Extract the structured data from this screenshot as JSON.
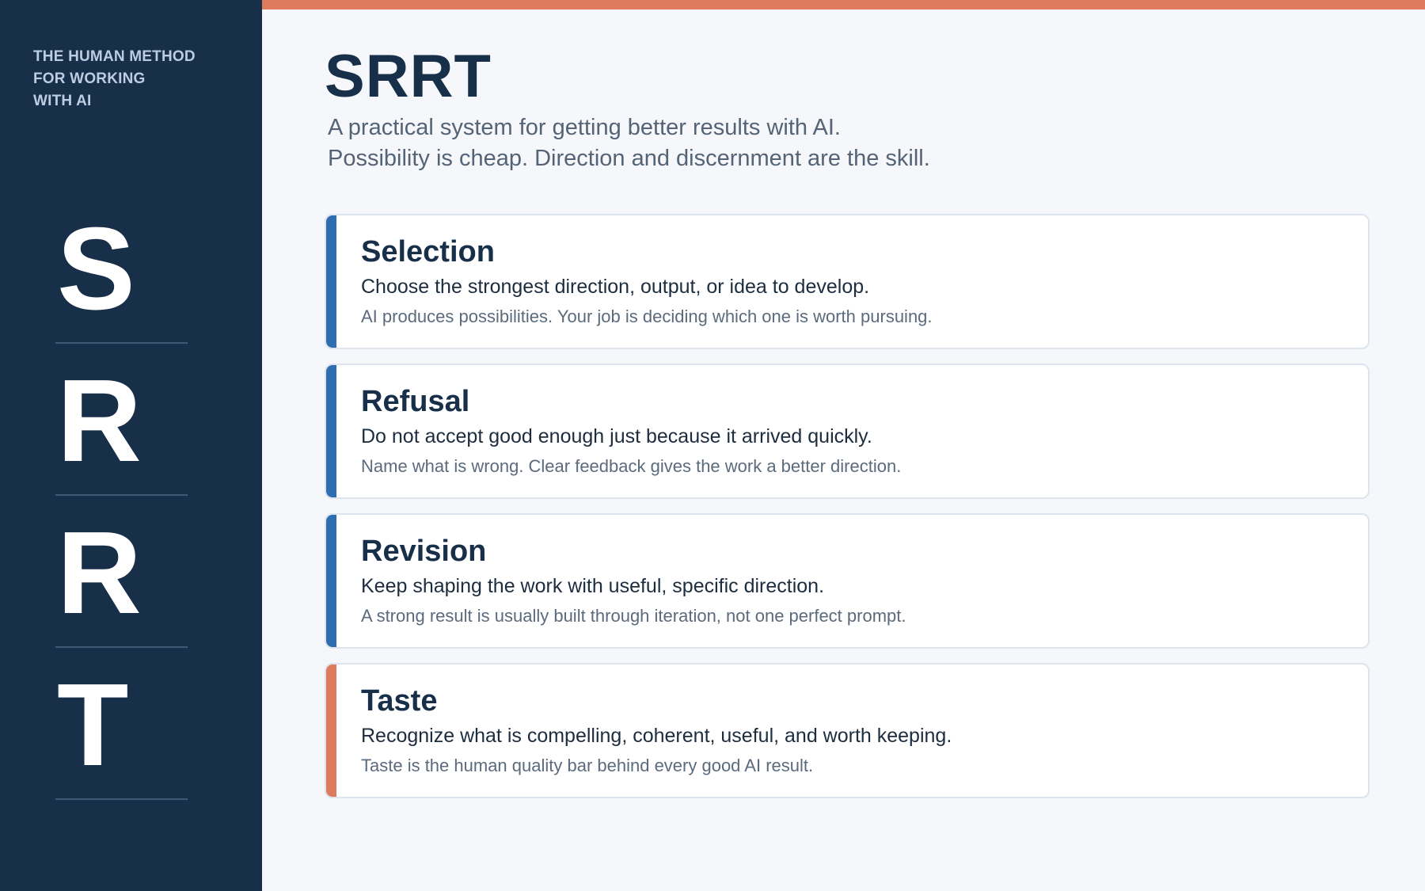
{
  "sidebar": {
    "tagline": [
      "THE HUMAN METHOD",
      "FOR WORKING",
      "WITH AI"
    ],
    "letters": [
      "S",
      "R",
      "R",
      "T"
    ]
  },
  "header": {
    "title": "SRRT",
    "subtitle": [
      "A practical system for getting better results with AI.",
      "Possibility is cheap. Direction and discernment are the skill."
    ]
  },
  "cards": [
    {
      "title": "Selection",
      "description": "Choose the strongest direction, output, or idea to develop.",
      "note": "AI produces possibilities. Your job is deciding which one is worth pursuing.",
      "accent": "#2e6db0"
    },
    {
      "title": "Refusal",
      "description": "Do not accept good enough just because it arrived quickly.",
      "note": "Name what is wrong. Clear feedback gives the work a better direction.",
      "accent": "#2e6db0"
    },
    {
      "title": "Revision",
      "description": "Keep shaping the work with useful, specific direction.",
      "note": "A strong result is usually built through iteration, not one perfect prompt.",
      "accent": "#2e6db0"
    },
    {
      "title": "Taste",
      "description": "Recognize what is compelling, coherent, useful, and worth keeping.",
      "note": "Taste is the human quality bar behind every good AI result.",
      "accent": "#de7b5f"
    }
  ],
  "colors": {
    "sidebar_bg": "#182f49",
    "top_bar": "#de7b5f",
    "page_bg": "#f5f7fb",
    "primary_accent": "#2e6db0",
    "highlight_accent": "#de7b5f"
  }
}
